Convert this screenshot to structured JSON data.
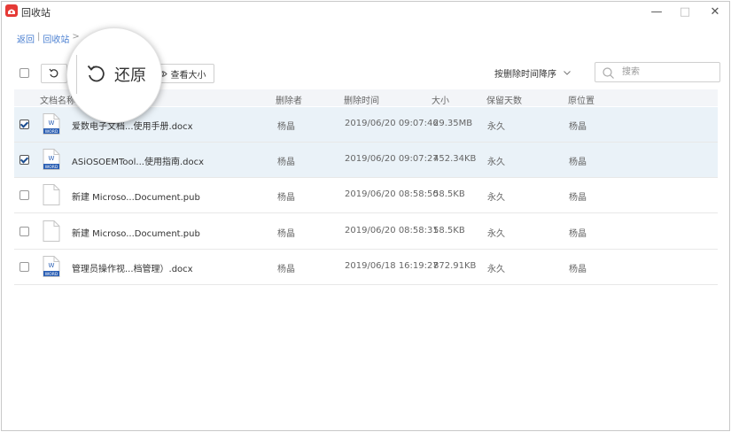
{
  "window": {
    "title": "回收站",
    "controls": {
      "minimize": "—",
      "maximize": "□",
      "close": "✕"
    }
  },
  "breadcrumb": {
    "back": "返回",
    "sep1": "|",
    "recycle": "回收站",
    "sep2": ">"
  },
  "toolbar": {
    "restore_label": "还原",
    "view_size_label": "查看大小",
    "sort_label": "按删除时间降序",
    "search_placeholder": "搜索"
  },
  "table": {
    "headers": {
      "name": "文档名称",
      "deleter": "删除者",
      "deleted_time": "删除时间",
      "size": "大小",
      "retention": "保留天数",
      "location": "原位置"
    },
    "rows": [
      {
        "selected": true,
        "icon": "word",
        "name": "爱数电子文档...使用手册.docx",
        "deleter": "杨晶",
        "time": "2019/06/20 09:07:46",
        "size": "29.35MB",
        "retention": "永久",
        "location": "杨晶"
      },
      {
        "selected": true,
        "icon": "word",
        "name": "ASiOSOEMTool...使用指南.docx",
        "deleter": "杨晶",
        "time": "2019/06/20 09:07:27",
        "size": "452.34KB",
        "retention": "永久",
        "location": "杨晶"
      },
      {
        "selected": false,
        "icon": "blank",
        "name": "新建 Microso...Document.pub",
        "deleter": "杨晶",
        "time": "2019/06/20 08:58:50",
        "size": "58.5KB",
        "retention": "永久",
        "location": "杨晶"
      },
      {
        "selected": false,
        "icon": "blank",
        "name": "新建 Microso...Document.pub",
        "deleter": "杨晶",
        "time": "2019/06/20 08:58:31",
        "size": "58.5KB",
        "retention": "永久",
        "location": "杨晶"
      },
      {
        "selected": false,
        "icon": "word",
        "name": "管理员操作视...档管理）.docx",
        "deleter": "杨晶",
        "time": "2019/06/18 16:19:27",
        "size": "872.91KB",
        "retention": "永久",
        "location": "杨晶"
      }
    ]
  },
  "word_icon_text": "W",
  "word_icon_tag": "WORD",
  "colors": {
    "accent": "#4a7fd1",
    "selected_row": "#eaf2f8",
    "app_icon": "#e53935"
  }
}
